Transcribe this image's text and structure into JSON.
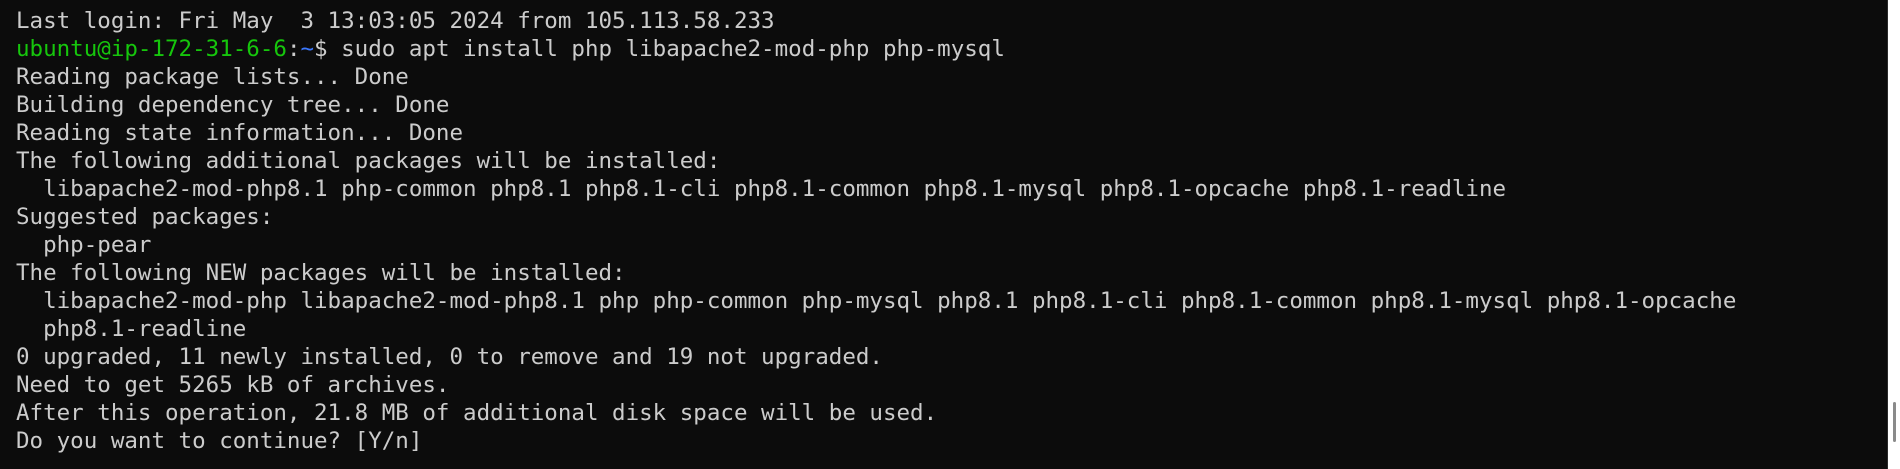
{
  "terminal": {
    "last_login": "Last login: Fri May  3 13:03:05 2024 from 105.113.58.233",
    "prompt": {
      "user_host": "ubuntu@ip-172-31-6-6",
      "separator": ":",
      "path": "~",
      "symbol": "$",
      "command": " sudo apt install php libapache2-mod-php php-mysql"
    },
    "output_lines": [
      "Reading package lists... Done",
      "Building dependency tree... Done",
      "Reading state information... Done",
      "The following additional packages will be installed:",
      "  libapache2-mod-php8.1 php-common php8.1 php8.1-cli php8.1-common php8.1-mysql php8.1-opcache php8.1-readline",
      "Suggested packages:",
      "  php-pear",
      "The following NEW packages will be installed:",
      "  libapache2-mod-php libapache2-mod-php8.1 php php-common php-mysql php8.1 php8.1-cli php8.1-common php8.1-mysql php8.1-opcache",
      "  php8.1-readline",
      "0 upgraded, 11 newly installed, 0 to remove and 19 not upgraded.",
      "Need to get 5265 kB of archives.",
      "After this operation, 21.8 MB of additional disk space will be used.",
      "Do you want to continue? [Y/n]"
    ],
    "colors": {
      "background": "#0c0c0c",
      "foreground": "#cccccc",
      "user_host": "#16c60c",
      "path": "#3b78ff"
    }
  }
}
